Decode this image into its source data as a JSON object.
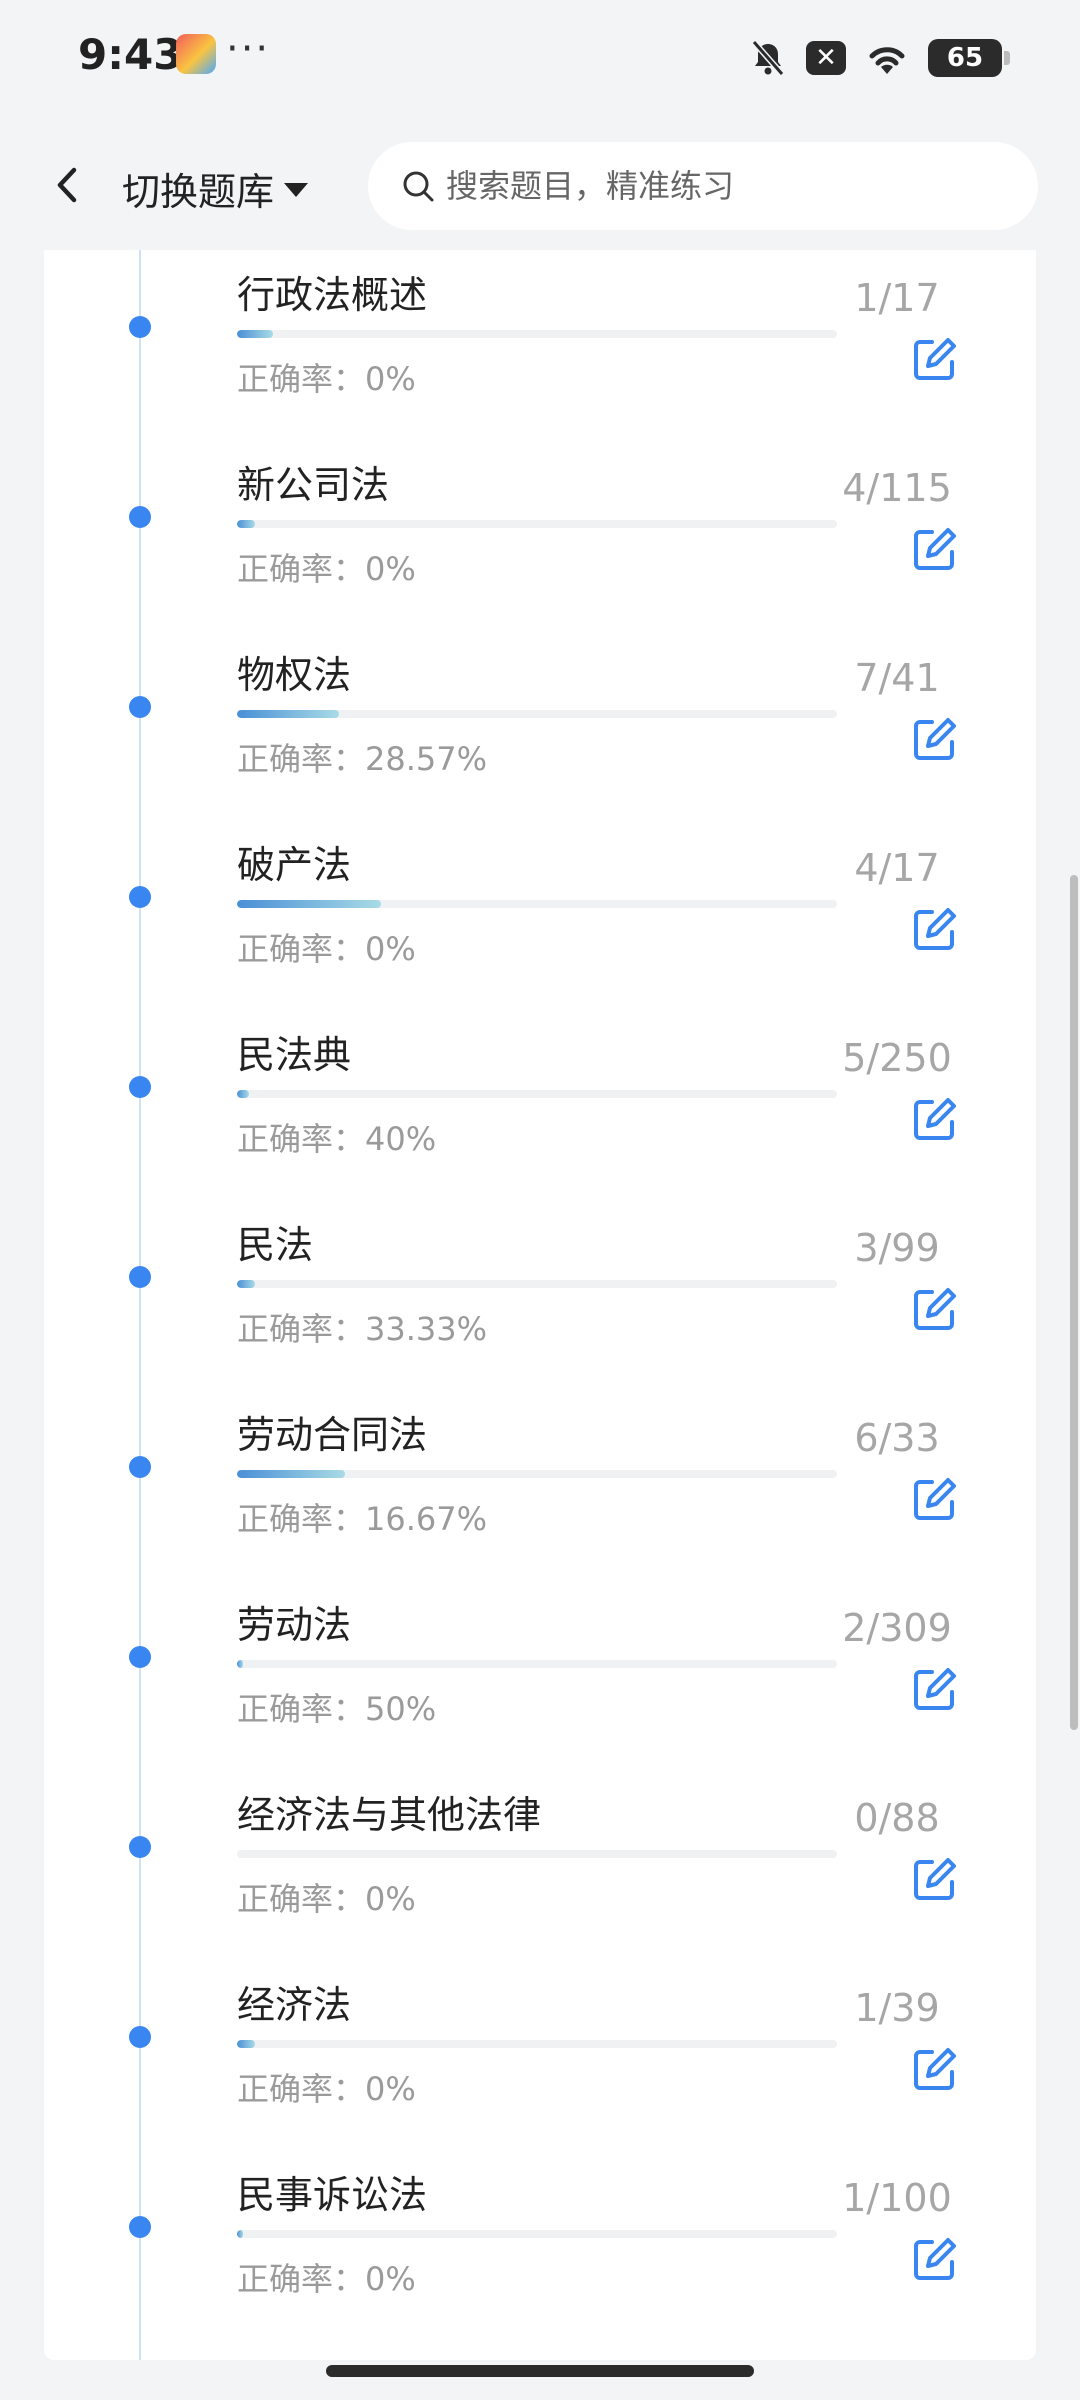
{
  "status": {
    "time": "9:43",
    "dots": "···",
    "battery": "65"
  },
  "header": {
    "bank_switch_label": "切换题库",
    "search_placeholder": "搜索题目，精准练习"
  },
  "accuracy_prefix": "正确率：",
  "chapters": [
    {
      "title": "行政法概述",
      "count": "1/17",
      "accuracy": "0%",
      "progress": 0.06
    },
    {
      "title": "新公司法",
      "count": "4/115",
      "accuracy": "0%",
      "progress": 0.03
    },
    {
      "title": "物权法",
      "count": "7/41",
      "accuracy": "28.57%",
      "progress": 0.17
    },
    {
      "title": "破产法",
      "count": "4/17",
      "accuracy": "0%",
      "progress": 0.24
    },
    {
      "title": "民法典",
      "count": "5/250",
      "accuracy": "40%",
      "progress": 0.02
    },
    {
      "title": "民法",
      "count": "3/99",
      "accuracy": "33.33%",
      "progress": 0.03
    },
    {
      "title": "劳动合同法",
      "count": "6/33",
      "accuracy": "16.67%",
      "progress": 0.18
    },
    {
      "title": "劳动法",
      "count": "2/309",
      "accuracy": "50%",
      "progress": 0.01
    },
    {
      "title": "经济法与其他法律",
      "count": "0/88",
      "accuracy": "0%",
      "progress": 0
    },
    {
      "title": "经济法",
      "count": "1/39",
      "accuracy": "0%",
      "progress": 0.03
    },
    {
      "title": "民事诉讼法",
      "count": "1/100",
      "accuracy": "0%",
      "progress": 0.01
    }
  ],
  "colors": {
    "accent": "#3a86f0",
    "edit_icon": "#3a86f0",
    "count_text": "#a6a6a6",
    "accuracy_text": "#9a9a9a"
  },
  "icons": {
    "back": "chevron-left-icon",
    "caret": "caret-down-icon",
    "search": "search-icon",
    "edit": "edit-icon"
  }
}
